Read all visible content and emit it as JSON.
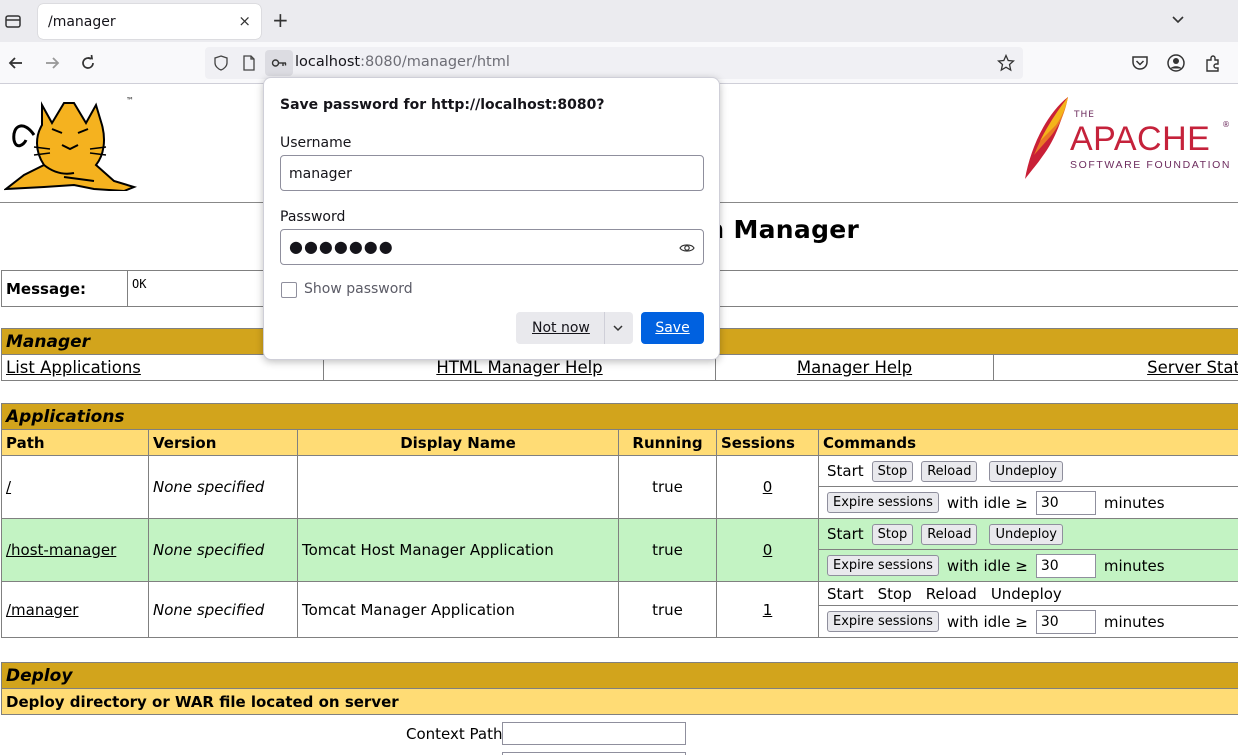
{
  "browser": {
    "tab_title": "/manager",
    "tab_close": "×",
    "new_tab": "+",
    "url_host": "localhost",
    "url_rest": ":8080/manager/html"
  },
  "page": {
    "title": "Tomcat Web Application Manager",
    "title_visible": "n Manager",
    "message_label": "Message:",
    "message_value": "OK",
    "manager_section": "Manager",
    "manager_links": [
      "List Applications",
      "HTML Manager Help",
      "Manager Help",
      "Server Stat"
    ],
    "applications_section": "Applications",
    "columns": [
      "Path",
      "Version",
      "Display Name",
      "Running",
      "Sessions",
      "Commands"
    ],
    "apps": [
      {
        "path": "/",
        "version": "None specified",
        "display": "",
        "running": "true",
        "sessions": "0"
      },
      {
        "path": "/host-manager",
        "version": "None specified",
        "display": "Tomcat Host Manager Application",
        "running": "true",
        "sessions": "0"
      },
      {
        "path": "/manager",
        "version": "None specified",
        "display": "Tomcat Manager Application",
        "running": "true",
        "sessions": "1"
      }
    ],
    "cmd": {
      "start": "Start",
      "stop": "Stop",
      "reload": "Reload",
      "undeploy": "Undeploy",
      "expire": "Expire sessions",
      "with_idle": "with idle ≥",
      "idle_value": "30",
      "minutes": "minutes"
    },
    "deploy_section": "Deploy",
    "deploy_sub": "Deploy directory or WAR file located on server",
    "context_path_label": "Context Path:"
  },
  "popup": {
    "title": "Save password for http://localhost:8080?",
    "username_label": "Username",
    "username_value": "manager",
    "password_label": "Password",
    "password_dots": "●●●●●●●",
    "show_password": "Show password",
    "not_now": "Not now",
    "save": "Save"
  },
  "colors": {
    "section_header": "#d2a41c",
    "column_header": "#ffdc75",
    "row_highlight": "#c3f3c3",
    "save_button": "#0061e0"
  }
}
